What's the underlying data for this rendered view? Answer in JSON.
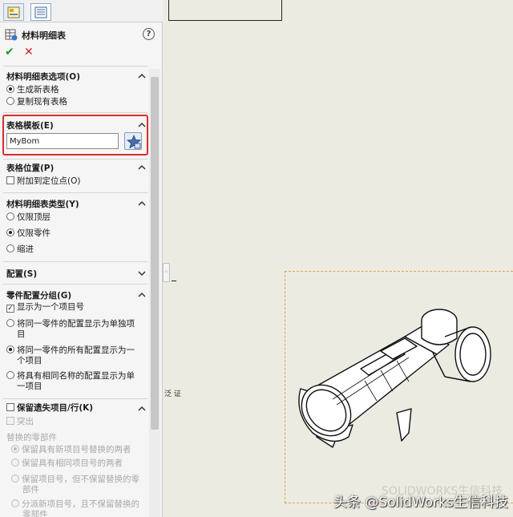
{
  "panel": {
    "title": "材料明细表",
    "help_glyph": "?",
    "ok_glyph": "✔",
    "cancel_glyph": "✕"
  },
  "sections": {
    "bom_options": {
      "title": "材料明细表选项(O)",
      "opt_new": "生成新表格",
      "opt_copy": "复制现有表格"
    },
    "table_template": {
      "title": "表格模板(E)",
      "value": "MyBom"
    },
    "table_position": {
      "title": "表格位置(P)",
      "opt_attach": "附加到定位点(O)"
    },
    "bom_type": {
      "title": "材料明细表类型(Y)",
      "opt_top": "仅限顶层",
      "opt_parts": "仅限零件",
      "opt_indented": "缩进"
    },
    "configurations": {
      "title": "配置(S)"
    },
    "part_config_grouping": {
      "title": "零件配置分组(G)",
      "opt_one_item": "显示为一个项目号",
      "opt_separate_1": "将同一零件的配置显示为单独项",
      "opt_separate_2": "目",
      "opt_all_one_1": "将同一零件的所有配置显示为一",
      "opt_all_one_2": "个项目",
      "opt_same_name_1": "将具有相同名称的配置显示为单",
      "opt_same_name_2": "一项目"
    },
    "keep_missing": {
      "title": "保留遗失项目/行(K)",
      "opt_strike": "突出",
      "replaced_label": "替换的零部件",
      "opt_keep_both_new": "保留具有新项目号替换的两者",
      "opt_keep_both_same": "保留具有相同项目号的两者",
      "opt_keep_no_replace_1": "保留项目号，但不保留替换的零",
      "opt_keep_no_replace_2": "部件",
      "opt_new_no_keep_1": "分派新项目号，且不保留替换的",
      "opt_new_no_keep_2": "零部件"
    }
  },
  "graphics": {
    "stray_text": "泛 证",
    "watermark": "头条 @SolidWorks生信科技",
    "watermark_ghost": "SOLIDWORKS生信科技"
  },
  "colors": {
    "accent_red": "#d6302a",
    "ok_green": "#1e9a2a",
    "selection_orange": "#e0a050"
  }
}
